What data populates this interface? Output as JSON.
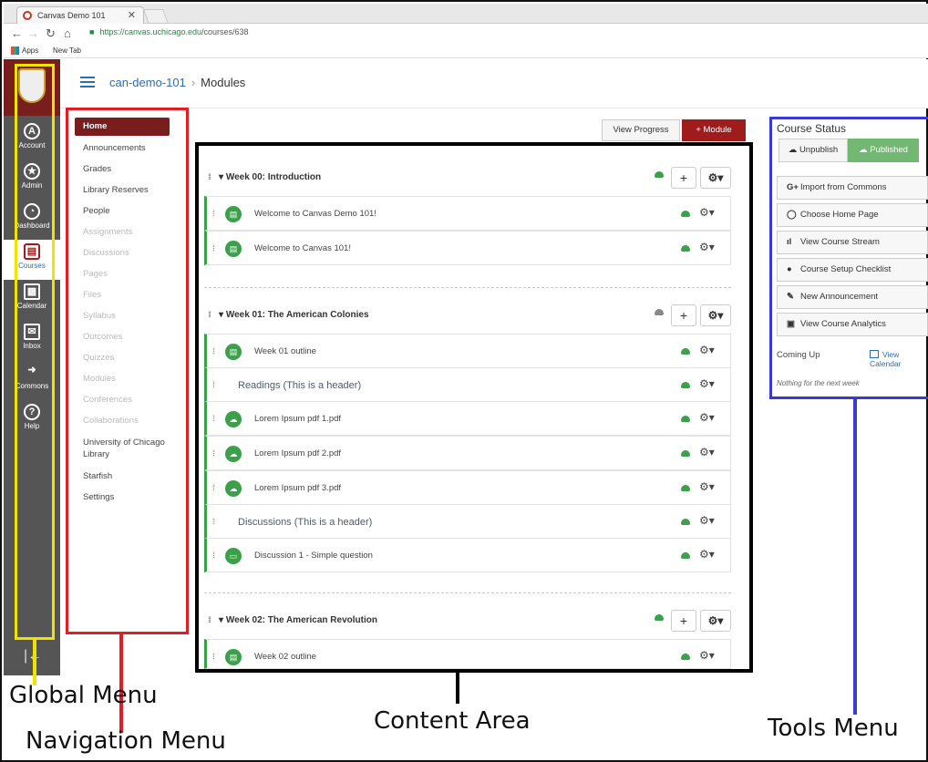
{
  "browser": {
    "tab_title": "Canvas Demo 101",
    "url_host": "https://canvas.uchicago.edu",
    "url_path": "/courses/638",
    "bookmarks": [
      "Apps",
      "New Tab"
    ]
  },
  "global_nav": {
    "items": [
      {
        "label": "Account",
        "icon": "A"
      },
      {
        "label": "Admin",
        "icon": "★"
      },
      {
        "label": "Dashboard",
        "icon": "◔"
      },
      {
        "label": "Courses",
        "icon": "▤"
      },
      {
        "label": "Calendar",
        "icon": "▦"
      },
      {
        "label": "Inbox",
        "icon": "✉"
      },
      {
        "label": "Commons",
        "icon": "➜"
      },
      {
        "label": "Help",
        "icon": "?"
      }
    ],
    "collapse_icon": "|←"
  },
  "header": {
    "course": "can-demo-101",
    "page": "Modules"
  },
  "course_nav": {
    "items": [
      {
        "label": "Home",
        "state": "active"
      },
      {
        "label": "Announcements",
        "state": "enabled"
      },
      {
        "label": "Grades",
        "state": "enabled"
      },
      {
        "label": "Library Reserves",
        "state": "enabled"
      },
      {
        "label": "People",
        "state": "enabled"
      },
      {
        "label": "Assignments",
        "state": "disabled"
      },
      {
        "label": "Discussions",
        "state": "disabled"
      },
      {
        "label": "Pages",
        "state": "disabled"
      },
      {
        "label": "Files",
        "state": "disabled"
      },
      {
        "label": "Syllabus",
        "state": "disabled"
      },
      {
        "label": "Outcomes",
        "state": "disabled"
      },
      {
        "label": "Quizzes",
        "state": "disabled"
      },
      {
        "label": "Modules",
        "state": "disabled"
      },
      {
        "label": "Conferences",
        "state": "disabled"
      },
      {
        "label": "Collaborations",
        "state": "disabled"
      },
      {
        "label": "University of Chicago Library",
        "state": "enabled"
      },
      {
        "label": "Starfish",
        "state": "enabled"
      },
      {
        "label": "Settings",
        "state": "enabled"
      }
    ]
  },
  "toolbar": {
    "view_progress": "View Progress",
    "add_module": "+ Module"
  },
  "modules": [
    {
      "title": "Week 00: Introduction",
      "published": true,
      "items": [
        {
          "type": "page",
          "label": "Welcome to Canvas Demo 101!"
        },
        {
          "type": "page",
          "label": "Welcome to Canvas 101!"
        }
      ]
    },
    {
      "title": "Week 01: The American Colonies",
      "published": false,
      "items": [
        {
          "type": "page",
          "label": "Week 01 outline"
        },
        {
          "type": "header",
          "label": "Readings (This is a header)"
        },
        {
          "type": "file",
          "label": "Lorem Ipsum pdf 1.pdf"
        },
        {
          "type": "file",
          "label": "Lorem Ipsum pdf 2.pdf"
        },
        {
          "type": "file",
          "label": "Lorem Ipsum pdf 3.pdf"
        },
        {
          "type": "header",
          "label": "Discussions (This is a header)"
        },
        {
          "type": "discussion",
          "label": "Discussion 1 - Simple question"
        }
      ]
    },
    {
      "title": "Week 02: The American Revolution",
      "published": true,
      "items": [
        {
          "type": "page",
          "label": "Week 02 outline"
        }
      ]
    }
  ],
  "tools": {
    "course_status": "Course Status",
    "unpublish": "Unpublish",
    "published": "Published",
    "buttons": [
      {
        "icon": "G+",
        "label": "Import from Commons"
      },
      {
        "icon": "◯",
        "label": "Choose Home Page"
      },
      {
        "icon": "ıl",
        "label": "View Course Stream"
      },
      {
        "icon": "●",
        "label": "Course Setup Checklist"
      },
      {
        "icon": "✎",
        "label": "New Announcement"
      },
      {
        "icon": "▣",
        "label": "View Course Analytics"
      }
    ],
    "coming_up": "Coming Up",
    "view_calendar": "View Calendar",
    "nothing": "Nothing for the next week"
  },
  "annotations": {
    "global": "Global Menu",
    "navigation": "Navigation Menu",
    "content": "Content Area",
    "tools": "Tools Menu"
  },
  "colors": {
    "brand_maroon": "#7a1d1d",
    "module_button": "#a01c1c",
    "published_green": "#3aa04a",
    "link_blue": "#2d6cb5",
    "box_global": "#f2e200",
    "box_nav": "#e02020",
    "box_tools": "#3a3ad0"
  }
}
